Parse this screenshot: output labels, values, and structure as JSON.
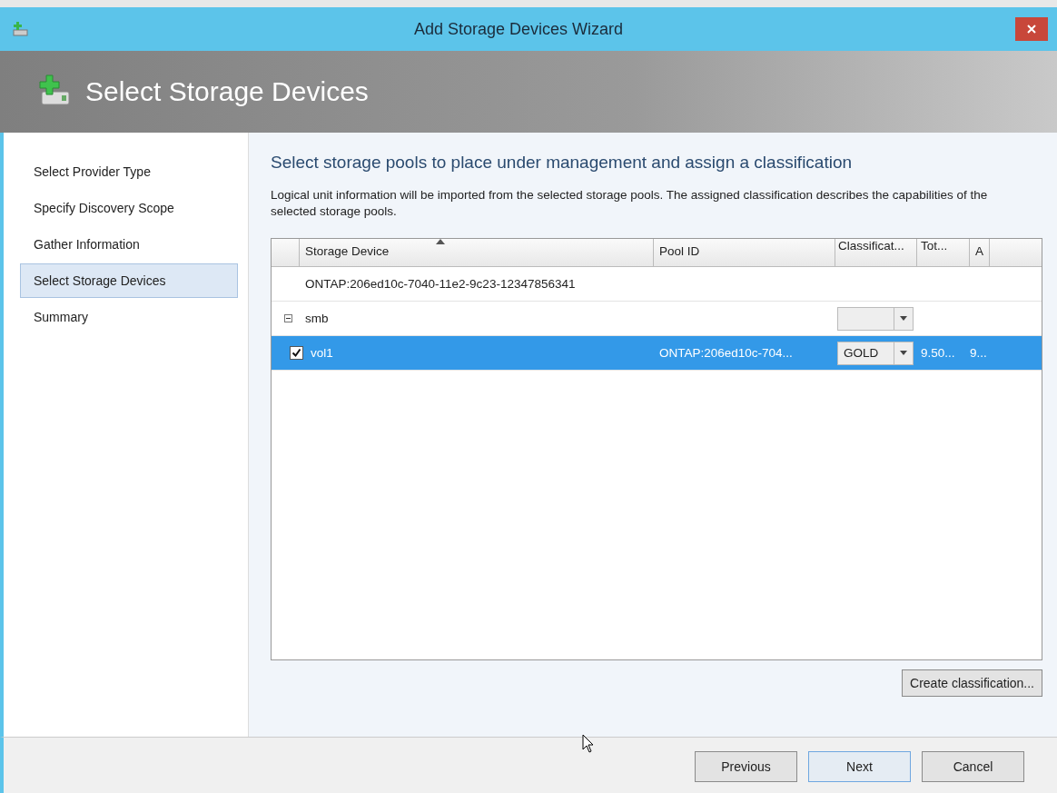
{
  "window": {
    "title": "Add Storage Devices Wizard"
  },
  "header": {
    "title": "Select Storage Devices"
  },
  "steps": [
    {
      "label": "Select Provider Type",
      "selected": false
    },
    {
      "label": "Specify Discovery Scope",
      "selected": false
    },
    {
      "label": "Gather Information",
      "selected": false
    },
    {
      "label": "Select Storage Devices",
      "selected": true
    },
    {
      "label": "Summary",
      "selected": false
    }
  ],
  "content": {
    "heading": "Select storage pools to place under management and assign a classification",
    "description": "Logical unit information will be imported from the selected storage pools. The assigned classification describes the capabilities of the selected storage pools."
  },
  "table": {
    "columns": [
      "Storage Device",
      "Pool ID",
      "Classificat...",
      "Tot...",
      "A"
    ],
    "rows": [
      {
        "kind": "provider",
        "device": "ONTAP:206ed10c-7040-11e2-9c23-12347856341",
        "children": [
          {
            "kind": "pool",
            "device": "smb",
            "expanded": true,
            "children": [
              {
                "kind": "volume",
                "device": "vol1",
                "checked": true,
                "selected": true,
                "pool_id": "ONTAP:206ed10c-704...",
                "classification": "GOLD",
                "total": "9.50...",
                "column_5": "9..."
              }
            ]
          }
        ]
      }
    ]
  },
  "create_button": "Create classification...",
  "buttons": [
    {
      "label": "Previous",
      "focused": false
    },
    {
      "label": "Next",
      "focused": true
    },
    {
      "label": "Cancel",
      "focused": false
    }
  ]
}
